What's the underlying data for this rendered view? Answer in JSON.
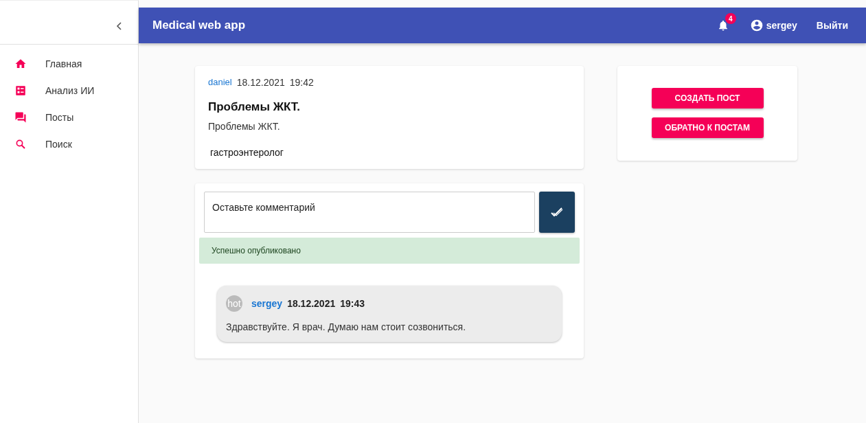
{
  "app_bar": {
    "title": "Medical web app",
    "notifications_count": "4",
    "user": "sergey",
    "logout": "Выйти"
  },
  "sidebar": {
    "items": [
      {
        "label": "Главная"
      },
      {
        "label": "Анализ ИИ"
      },
      {
        "label": "Посты"
      },
      {
        "label": "Поиск"
      }
    ]
  },
  "post": {
    "author": "daniel",
    "date": "18.12.2021",
    "time": "19:42",
    "title": "Проблемы ЖКТ.",
    "body": "Проблемы ЖКТ.",
    "tag": "гастроэнтеролог"
  },
  "comment_form": {
    "placeholder": "Оставьте комментарий",
    "alert": "Успешно опубликовано"
  },
  "comments": [
    {
      "avatar_text": "hot",
      "author": "sergey",
      "date": "18.12.2021",
      "time": "19:43",
      "text": "Здравствуйте. Я врач. Думаю нам стоит созвониться."
    }
  ],
  "actions": [
    "СОЗДАТЬ ПОСТ",
    "ОБРАТНО К ПОСТАМ"
  ]
}
